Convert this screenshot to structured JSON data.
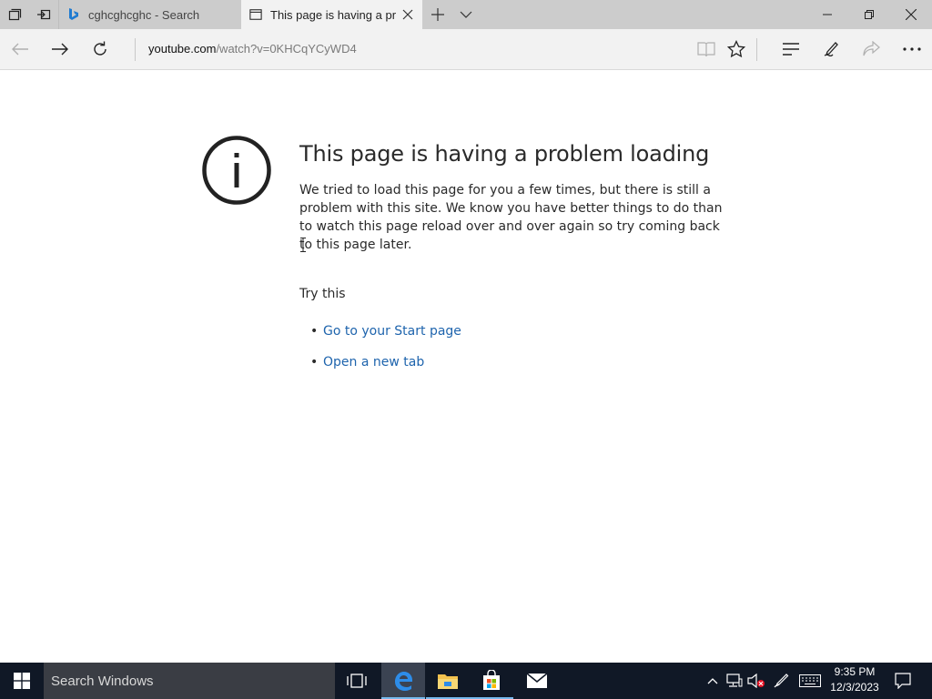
{
  "browser": {
    "tabs": [
      {
        "title": "cghcghcghc - Search",
        "icon": "bing-icon",
        "active": false
      },
      {
        "title": "This page is having a pr",
        "icon": "page-icon",
        "active": true
      }
    ],
    "address": {
      "host": "youtube.com",
      "path": "/watch?v=0KHCqYCyWD4"
    },
    "accent_color": "#1e64ad"
  },
  "error_page": {
    "title": "This page is having a problem loading",
    "description": "We tried to load this page for you a few times, but there is still a problem with this site. We know you have better things to do than to watch this page reload over and over again so try coming back to this page later.",
    "try_this": "Try this",
    "suggestions": [
      "Go to your Start page",
      "Open a new tab"
    ],
    "icon": "info-icon"
  },
  "taskbar": {
    "search_placeholder": "Search Windows",
    "time": "9:35 PM",
    "date": "12/3/2023",
    "apps": [
      "task-view-icon",
      "edge-icon",
      "file-explorer-icon",
      "store-icon",
      "mail-icon"
    ]
  }
}
